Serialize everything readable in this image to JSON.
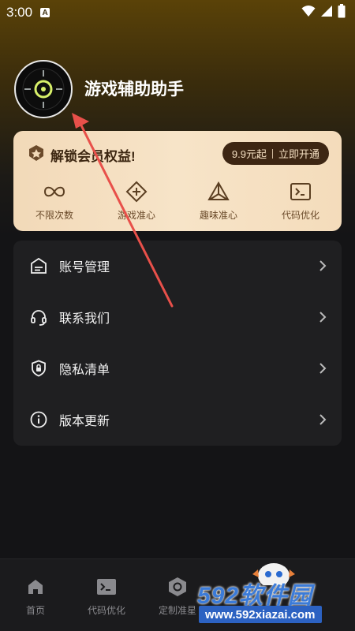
{
  "status_bar": {
    "time": "3:00",
    "notification_badge": "A",
    "icons": [
      "wifi-icon",
      "signal-icon",
      "battery-icon"
    ]
  },
  "profile": {
    "app_name": "游戏辅助助手"
  },
  "vip_card": {
    "title": "解锁会员权益!",
    "price_text": "9.9元起",
    "cta_text": "立即开通",
    "features": [
      {
        "label": "不限次数",
        "icon": "infinity-icon"
      },
      {
        "label": "游戏准心",
        "icon": "crosshair-plus-icon"
      },
      {
        "label": "趣味准心",
        "icon": "triangle-crosshair-icon"
      },
      {
        "label": "代码优化",
        "icon": "terminal-icon"
      }
    ],
    "colors": {
      "background": "#f5dfc0",
      "button": "#3d2613",
      "text": "#3d2712"
    }
  },
  "menu": {
    "items": [
      {
        "label": "账号管理",
        "icon": "account-card-icon"
      },
      {
        "label": "联系我们",
        "icon": "headset-icon"
      },
      {
        "label": "隐私清单",
        "icon": "shield-lock-icon"
      },
      {
        "label": "版本更新",
        "icon": "info-icon"
      }
    ]
  },
  "bottom_nav": {
    "items": [
      {
        "label": "首页",
        "icon": "home-icon"
      },
      {
        "label": "代码优化",
        "icon": "terminal-icon"
      },
      {
        "label": "定制准星",
        "icon": "hexagon-target-icon"
      }
    ]
  },
  "watermark": {
    "brand": "592软件园",
    "url": "www.592xiazai.com"
  }
}
